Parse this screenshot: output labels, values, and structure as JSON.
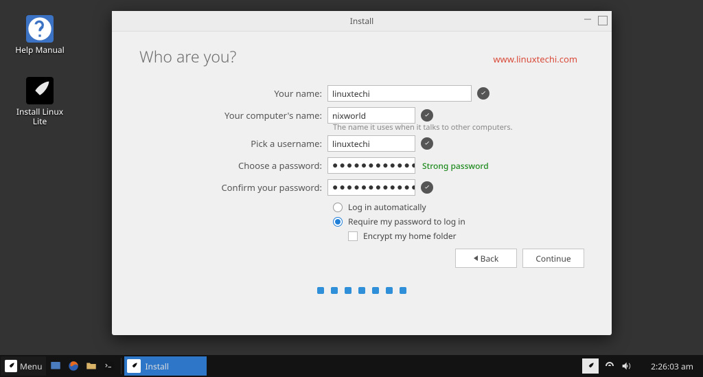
{
  "desktop": {
    "help_label": "Help Manual",
    "install_label_l1": "Install Linux",
    "install_label_l2": "Lite"
  },
  "window": {
    "title": "Install",
    "heading": "Who are you?",
    "watermark": "www.linuxtechi.com"
  },
  "form": {
    "name_label": "Your name:",
    "name_value": "linuxtechi",
    "computer_label": "Your computer's name:",
    "computer_value": "nixworld",
    "computer_hint": "The name it uses when it talks to other computers.",
    "user_label": "Pick a username:",
    "user_value": "linuxtechi",
    "pw_label": "Choose a password:",
    "pw_value": "●●●●●●●●●●●●●",
    "pw_strength": "Strong password",
    "pw2_label": "Confirm your password:",
    "pw2_value": "●●●●●●●●●●●●●",
    "login_auto": "Log in automatically",
    "login_req": "Require my password to log in",
    "encrypt": "Encrypt my home folder"
  },
  "buttons": {
    "back": "Back",
    "continue": "Continue"
  },
  "taskbar": {
    "menu": "Menu",
    "install": "Install",
    "clock": "2:26:03 am"
  }
}
